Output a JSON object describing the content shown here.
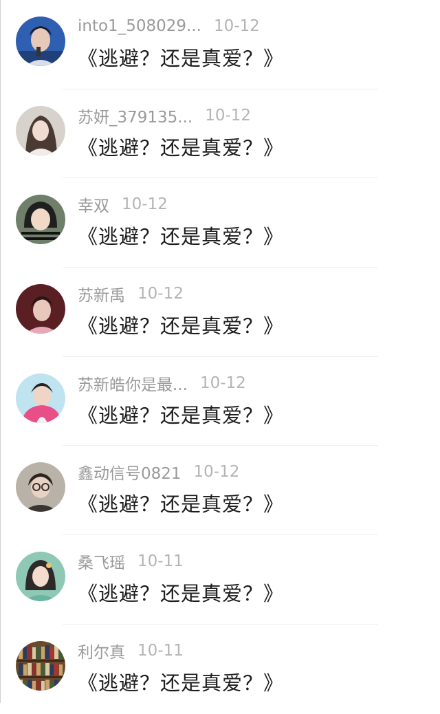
{
  "comments": [
    {
      "username": "into1_508029...",
      "date": "10-12",
      "message": "《逃避？还是真爱？》",
      "avatar_icon": "avatar-young-man-blue-stage",
      "avatar_colors": [
        "#2f5fb0",
        "#e6c9b8",
        "#1a1a2a"
      ]
    },
    {
      "username": "苏妍_379135...",
      "date": "10-12",
      "message": "《逃避？还是真爱？》",
      "avatar_icon": "avatar-girl-light-room",
      "avatar_colors": [
        "#d8d2cc",
        "#f0dcd0",
        "#4a3a34"
      ]
    },
    {
      "username": "幸双",
      "date": "10-12",
      "message": "《逃避？还是真爱？》",
      "avatar_icon": "avatar-child-striped",
      "avatar_colors": [
        "#6f7f6a",
        "#f1d9c8",
        "#1f1f1f"
      ]
    },
    {
      "username": "苏新禹",
      "date": "10-12",
      "message": "《逃避？还是真爱？》",
      "avatar_icon": "avatar-young-man-dark-red",
      "avatar_colors": [
        "#5a1f22",
        "#e8c8bd",
        "#2a1616"
      ]
    },
    {
      "username": "苏新皓你是最...",
      "date": "10-12",
      "message": "《逃避？还是真爱？》",
      "avatar_icon": "avatar-boy-pink-jacket",
      "avatar_colors": [
        "#bfe3f0",
        "#e84f86",
        "#222222"
      ]
    },
    {
      "username": "鑫动信号0821",
      "date": "10-12",
      "message": "《逃避？还是真爱？》",
      "avatar_icon": "avatar-young-man-glasses",
      "avatar_colors": [
        "#b9b2a8",
        "#ead2c2",
        "#2b2622"
      ]
    },
    {
      "username": "桑飞瑶",
      "date": "10-11",
      "message": "《逃避？还是真爱？》",
      "avatar_icon": "avatar-illustrated-woman-green",
      "avatar_colors": [
        "#8fc8b4",
        "#f3dccd",
        "#2e2a2a"
      ]
    },
    {
      "username": "利尔真",
      "date": "10-11",
      "message": "《逃避？还是真爱？》",
      "avatar_icon": "avatar-bookshelf",
      "avatar_colors": [
        "#6b4a2c",
        "#c9a36b",
        "#2b3d5c"
      ]
    }
  ]
}
